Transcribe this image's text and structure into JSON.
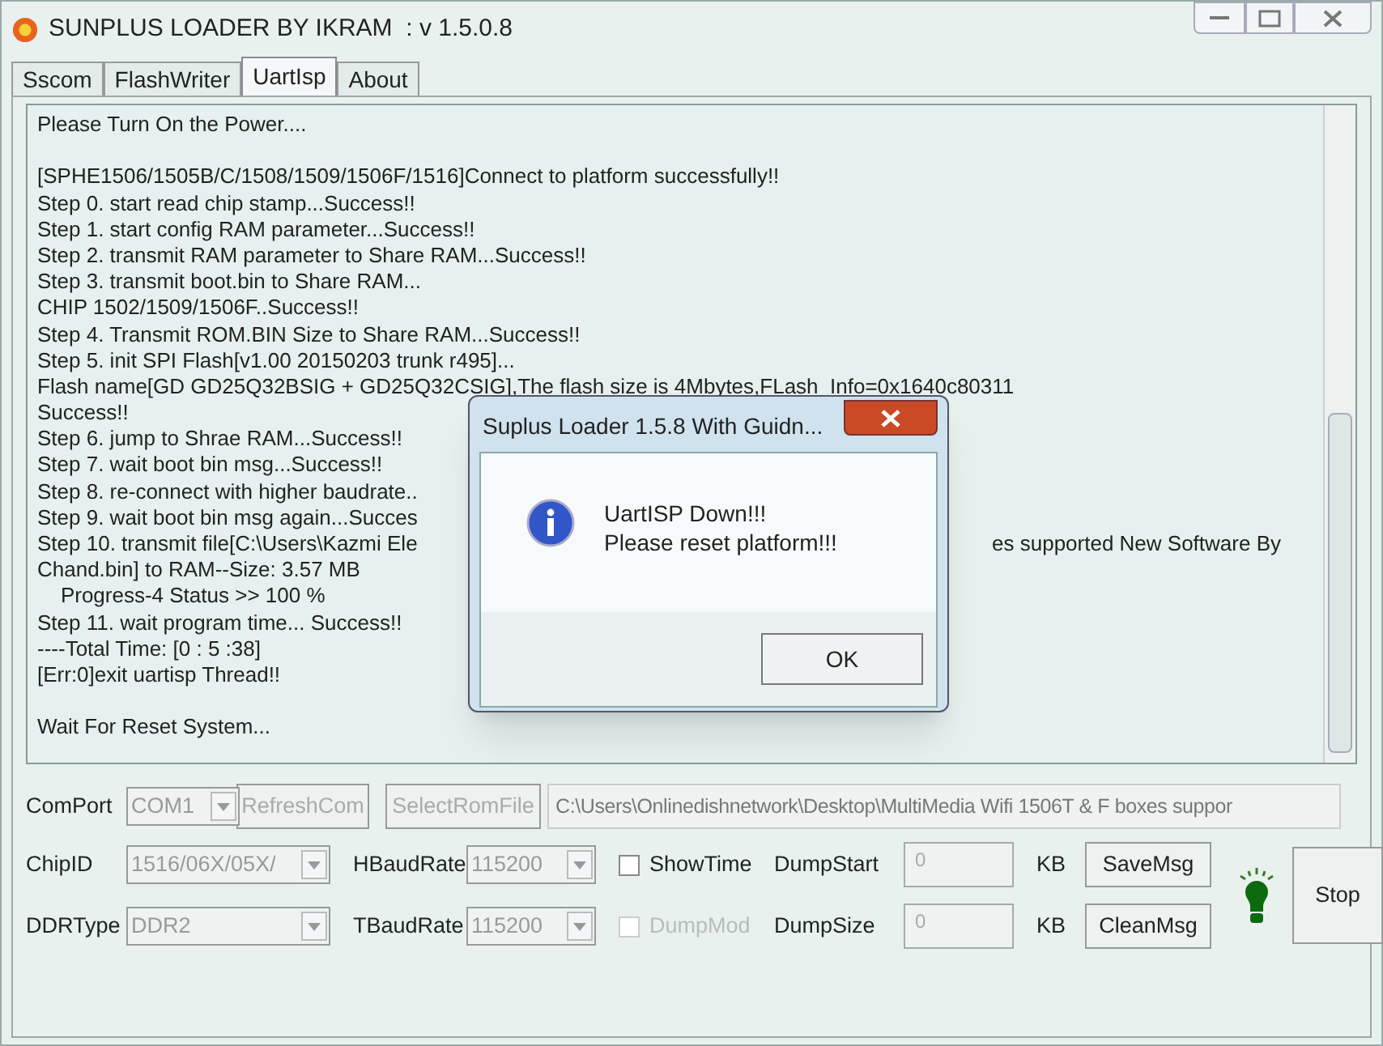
{
  "window": {
    "title": "SUNPLUS LOADER BY IKRAM  : v 1.5.0.8"
  },
  "tabs": [
    {
      "label": "Sscom",
      "selected": false
    },
    {
      "label": "FlashWriter",
      "selected": false
    },
    {
      "label": "UartIsp",
      "selected": true
    },
    {
      "label": "About",
      "selected": false
    }
  ],
  "log": [
    {
      "segments": [
        "Please Turn On the Power...."
      ],
      "gap_before": false
    },
    {
      "segments": [
        "[SPHE1506/1505B/C/1508/1509/1506F/1516]Connect to platform successfully!!"
      ],
      "gap_before": true
    },
    [
      "Step 0. start read chip stamp...Success!!"
    ],
    [
      "Step 1. start config RAM parameter...Success!!"
    ],
    [
      "Step 2. transmit RAM parameter to Share RAM...Success!!"
    ],
    [
      "Step 3. transmit boot.bin to Share RAM..."
    ],
    [
      "CHIP 1502/1509/1506F..Success!!"
    ],
    [
      "Step 4. Transmit ROM.BIN Size to Share RAM...Success!!"
    ],
    [
      "Step 5. init SPI Flash[v1.00 20150203 trunk r495]..."
    ],
    [
      "Flash name[GD GD25Q32BSIG + GD25Q32CSIG],The flash size is 4Mbytes,FLash_Info=0x1640c80311"
    ],
    [
      "Success!!"
    ],
    [
      "Step 6. jump to Shrae RAM...Success!!"
    ],
    [
      "Step 7. wait boot bin msg...Success!!"
    ],
    [
      "Step 8. re-connect with higher baudrate.."
    ],
    [
      "Step 9. wait boot bin msg again...Succes"
    ],
    [
      "Step 10. transmit file[C:\\Users\\Kazmi Ele",
      "es supported New Software By"
    ],
    [
      "Chand.bin] to RAM--Size: 3.57 MB"
    ],
    [
      "    Progress-4 Status >> 100 %"
    ],
    [
      "Step 11. wait program time... Success!!"
    ],
    [
      "----Total Time: [0 : 5 :38]"
    ],
    [
      "[Err:0]exit uartisp Thread!!"
    ],
    {
      "segments": [
        "Wait For Reset System..."
      ],
      "gap_before": true
    }
  ],
  "dialog": {
    "title": "Suplus Loader 1.5.8 With Guidn...",
    "message": [
      "UartISP Down!!!",
      "Please reset platform!!!"
    ],
    "button": "OK"
  },
  "com_port": {
    "label": "ComPort",
    "value": "COM1",
    "disabled": true
  },
  "refresh_button": {
    "label": "RefreshCom",
    "disabled": true
  },
  "select_rom_button": {
    "label": "SelectRomFile",
    "disabled": true
  },
  "rom_path": "C:\\Users\\Onlinedishnetwork\\Desktop\\MultiMedia Wifi 1506T & F boxes suppor",
  "chip_id": {
    "label": "ChipID",
    "value": "1516/06X/05X/",
    "disabled": true
  },
  "ddr_type": {
    "label": "DDRType",
    "value": "DDR2",
    "disabled": true
  },
  "h_baud": {
    "label": "HBaudRate",
    "value": "115200",
    "disabled": true
  },
  "t_baud": {
    "label": "TBaudRate",
    "value": "115200",
    "disabled": true
  },
  "show_time": {
    "label": "ShowTime",
    "checked": false,
    "disabled": false
  },
  "dump_mode": {
    "label": "DumpMod",
    "checked": false,
    "disabled": true
  },
  "dump_start": {
    "label": "DumpStart",
    "value": "0",
    "unit": "KB"
  },
  "dump_size": {
    "label": "DumpSize",
    "value": "0",
    "unit": "KB"
  },
  "save_button": {
    "label": "SaveMsg",
    "disabled": false
  },
  "clean_button": {
    "label": "CleanMsg",
    "disabled": false
  },
  "stop_button": {
    "label": "Stop",
    "disabled": false
  }
}
